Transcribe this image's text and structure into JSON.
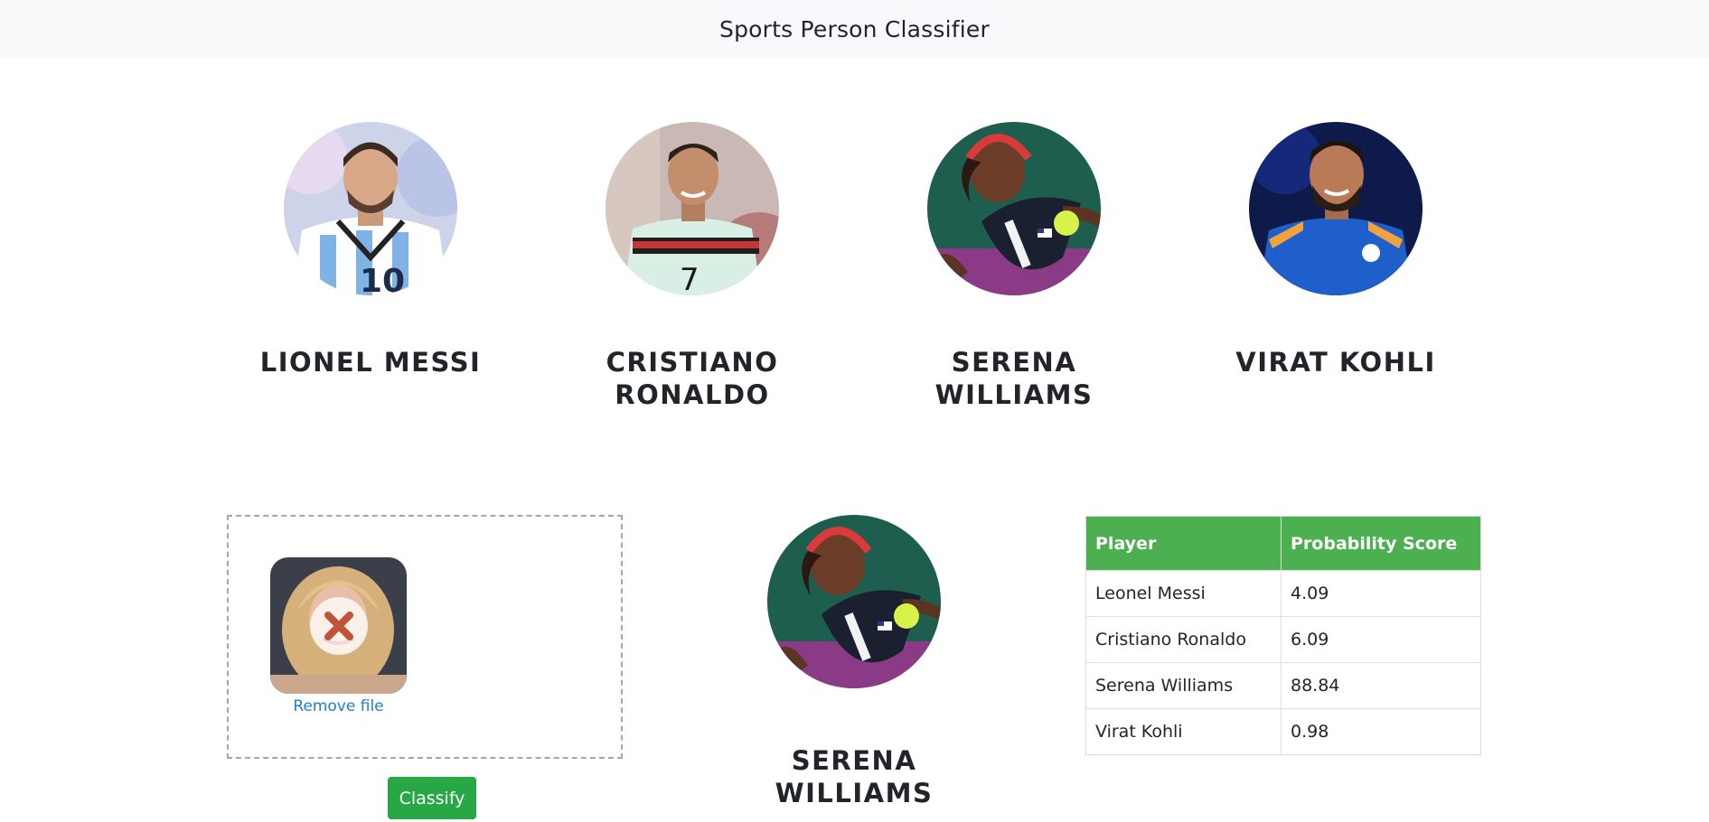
{
  "app": {
    "title": "Sports Person Classifier"
  },
  "players": [
    {
      "name": "LIONEL MESSI"
    },
    {
      "name": "CRISTIANO RONALDO"
    },
    {
      "name": "SERENA WILLIAMS"
    },
    {
      "name": "VIRAT KOHLI"
    }
  ],
  "upload": {
    "remove_label": "Remove file",
    "remove_icon": "close-x-icon"
  },
  "actions": {
    "classify_label": "Classify"
  },
  "result": {
    "name": "SERENA WILLIAMS"
  },
  "score_table": {
    "headers": [
      "Player",
      "Probability Score"
    ],
    "rows": [
      {
        "player": "Leonel Messi",
        "score": "4.09"
      },
      {
        "player": "Cristiano Ronaldo",
        "score": "6.09"
      },
      {
        "player": "Serena Williams",
        "score": "88.84"
      },
      {
        "player": "Virat Kohli",
        "score": "0.98"
      }
    ]
  },
  "colors": {
    "navbar_bg": "#f8f9fa",
    "table_header": "#4caf50",
    "button": "#28a745",
    "link": "#1a7fd4"
  }
}
